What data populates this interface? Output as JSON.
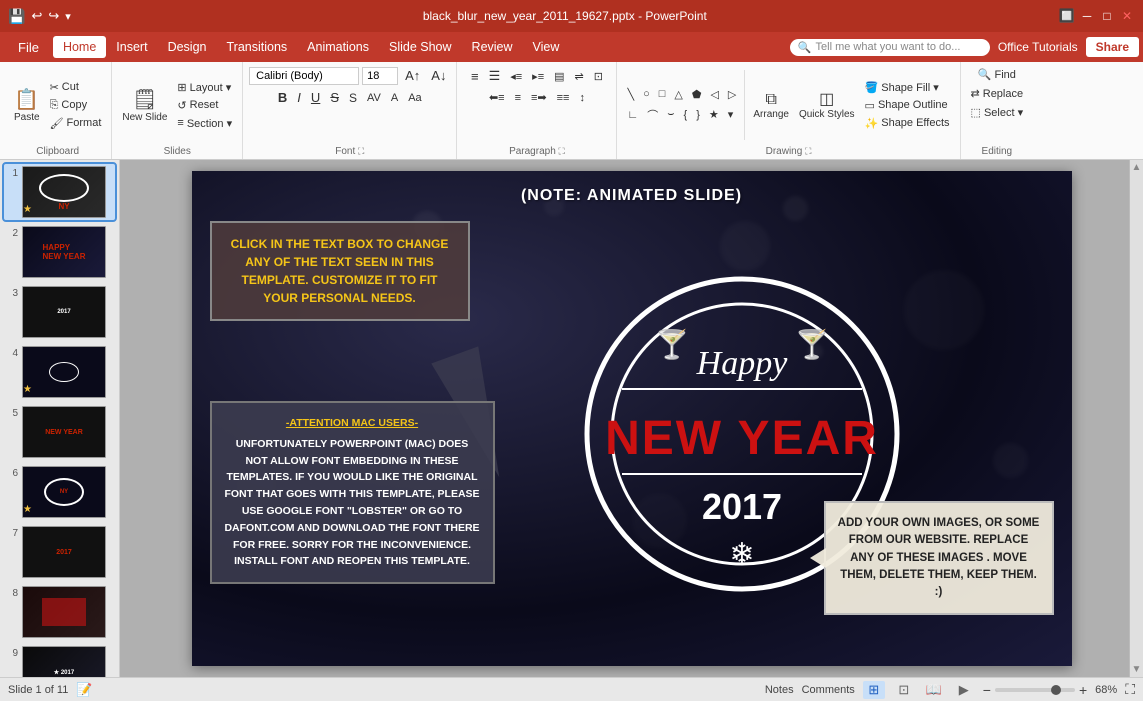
{
  "titlebar": {
    "filename": "black_blur_new_year_2011_19627.pptx - PowerPoint",
    "save_icon": "💾",
    "undo_icon": "↩",
    "redo_icon": "↪",
    "restore_icon": "🔲"
  },
  "menubar": {
    "file_label": "File",
    "tabs": [
      "Home",
      "Insert",
      "Design",
      "Transitions",
      "Animations",
      "Slide Show",
      "Review",
      "View"
    ],
    "active_tab": "Home",
    "search_placeholder": "Tell me what you want to do...",
    "office_tutorials": "Office Tutorials",
    "share": "Share"
  },
  "ribbon": {
    "groups": [
      {
        "name": "Clipboard",
        "label": "Clipboard"
      },
      {
        "name": "Slides",
        "label": "Slides"
      },
      {
        "name": "Font",
        "label": "Font"
      },
      {
        "name": "Paragraph",
        "label": "Paragraph"
      },
      {
        "name": "Drawing",
        "label": "Drawing"
      },
      {
        "name": "Editing",
        "label": "Editing"
      }
    ],
    "shape_fill": "Shape Fill ▾",
    "shape_outline": "Shape Outline",
    "shape_effects": "Shape Effects",
    "quick_styles": "Quick Styles",
    "arrange": "Arrange",
    "find": "Find",
    "replace": "Replace",
    "select": "Select ▾",
    "layout": "Layout ▾",
    "reset": "Reset",
    "section": "Section ▾",
    "new_slide": "New Slide"
  },
  "slides": [
    {
      "num": "1",
      "active": true,
      "star": true
    },
    {
      "num": "2",
      "active": false,
      "star": false
    },
    {
      "num": "3",
      "active": false,
      "star": false
    },
    {
      "num": "4",
      "active": false,
      "star": true
    },
    {
      "num": "5",
      "active": false,
      "star": false
    },
    {
      "num": "6",
      "active": false,
      "star": true
    },
    {
      "num": "7",
      "active": false,
      "star": false
    },
    {
      "num": "8",
      "active": false,
      "star": false
    },
    {
      "num": "9",
      "active": false,
      "star": false
    }
  ],
  "slide": {
    "note_text": "(NOTE: ANIMATED SLIDE)",
    "info_box_1": "CLICK IN THE TEXT BOX TO CHANGE ANY OF THE TEXT SEEN IN THIS TEMPLATE. CUSTOMIZE IT TO FIT YOUR PERSONAL NEEDS.",
    "info_box_2_attention": "-ATTENTION MAC USERS-",
    "info_box_2_body": "UNFORTUNATELY POWERPOINT (MAC) DOES NOT ALLOW FONT EMBEDDING IN THESE TEMPLATES. IF YOU WOULD LIKE THE ORIGINAL FONT THAT GOES WITH THIS TEMPLATE, PLEASE USE GOOGLE FONT \"LOBSTER\" OR GO TO DAFONT.COM AND DOWNLOAD THE FONT THERE FOR FREE. SORRY FOR THE INCONVENIENCE. INSTALL FONT AND REOPEN THIS TEMPLATE.",
    "info_box_3": "ADD YOUR OWN IMAGES, OR SOME FROM OUR WEBSITE. REPLACE ANY OF THESE IMAGES . MOVE THEM, DELETE THEM, KEEP THEM. :)",
    "happy": "Happy",
    "new_year": "NEW YEAR",
    "year": "2017"
  },
  "statusbar": {
    "slide_info": "Slide 1 of 11",
    "notes_label": "Notes",
    "comments_label": "Comments",
    "zoom_level": "68%"
  }
}
